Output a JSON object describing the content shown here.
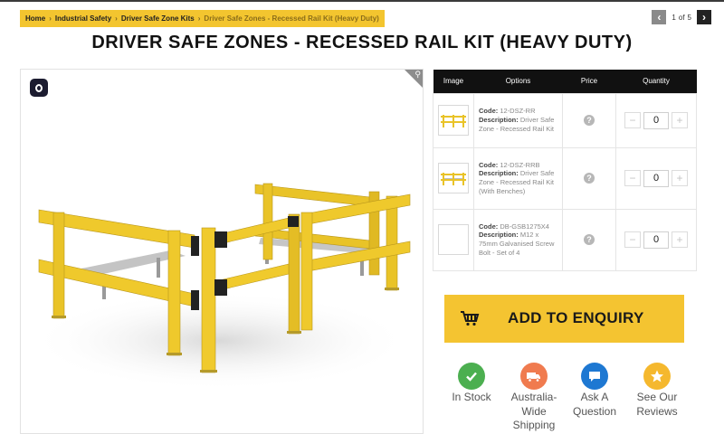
{
  "breadcrumb": {
    "items": [
      "Home",
      "Industrial Safety",
      "Driver Safe Zone Kits"
    ],
    "current": "Driver Safe Zones - Recessed Rail Kit (Heavy Duty)"
  },
  "pager": {
    "current": "1",
    "of": "of",
    "total": "5"
  },
  "page_title": "DRIVER SAFE ZONES - RECESSED RAIL KIT (HEAVY DUTY)",
  "table": {
    "headers": [
      "Image",
      "Options",
      "Price",
      "Quantity"
    ],
    "rows": [
      {
        "code_label": "Code:",
        "code": "12-DSZ-RR",
        "desc_label": "Description:",
        "description": "Driver Safe Zone - Recessed Rail Kit",
        "price_icon": "?",
        "quantity": "0"
      },
      {
        "code_label": "Code:",
        "code": "12-DSZ-RRB",
        "desc_label": "Description:",
        "description": "Driver Safe Zone - Recessed Rail Kit (With Benches)",
        "price_icon": "?",
        "quantity": "0"
      },
      {
        "code_label": "Code:",
        "code": "DB-GSB1275X4",
        "desc_label": "Description:",
        "description": "M12 x 75mm Galvanised Screw Bolt - Set of 4",
        "price_icon": "?",
        "quantity": "0"
      }
    ],
    "minus": "−",
    "plus": "+"
  },
  "enquiry": {
    "label": "ADD TO ENQUIRY"
  },
  "features": [
    {
      "label": "In Stock",
      "color": "#4caf50",
      "icon": "check-icon"
    },
    {
      "label": "Australia-Wide Shipping",
      "color": "#f07b4f",
      "icon": "truck-icon"
    },
    {
      "label": "Ask A Question",
      "color": "#1e78d2",
      "icon": "chat-icon"
    },
    {
      "label": "See Our Reviews",
      "color": "#f5b82e",
      "icon": "star-icon"
    }
  ],
  "colors": {
    "accent": "#f4c431",
    "breadcrumb_bg": "#f3c52f",
    "header_bg": "#111111",
    "rail": "#e9c328"
  }
}
